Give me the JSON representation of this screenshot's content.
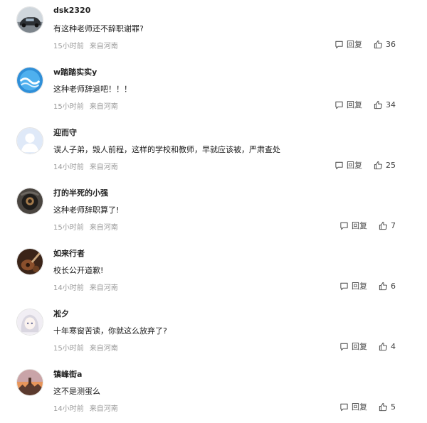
{
  "reply_label": "回复",
  "comments": [
    {
      "username": "dsk2320",
      "content": "有这种老师还不辞职谢罪?",
      "time": "15小时前",
      "location": "来自河南",
      "likes": "36",
      "avatar_icon": "car-photo"
    },
    {
      "username": "w踏踏实实y",
      "content": "这种老师辞退吧！！！",
      "time": "15小时前",
      "location": "来自河南",
      "likes": "34",
      "avatar_icon": "blue-wave-logo"
    },
    {
      "username": "迎而守",
      "content": "误人子弟，毁人前程，这样的学校和教师，早就应该被，严肃查处",
      "time": "14小时前",
      "location": "来自河南",
      "likes": "25",
      "avatar_icon": "default-user"
    },
    {
      "username": "打的半死的小强",
      "content": "这种老师辞职算了!",
      "time": "15小时前",
      "location": "来自河南",
      "likes": "7",
      "avatar_icon": "dark-character"
    },
    {
      "username": "如来行者",
      "content": "校长公开道歉!",
      "time": "14小时前",
      "location": "来自河南",
      "likes": "6",
      "avatar_icon": "guitar-photo"
    },
    {
      "username": "凇夕",
      "content": "十年寒窗苦读，你就这么放弃了?",
      "time": "15小时前",
      "location": "来自河南",
      "likes": "4",
      "avatar_icon": "anime-girl"
    },
    {
      "username": "镇峰街a",
      "content": "这不是测蛋么",
      "time": "14小时前",
      "location": "来自河南",
      "likes": "5",
      "avatar_icon": "sunset-photo"
    }
  ]
}
